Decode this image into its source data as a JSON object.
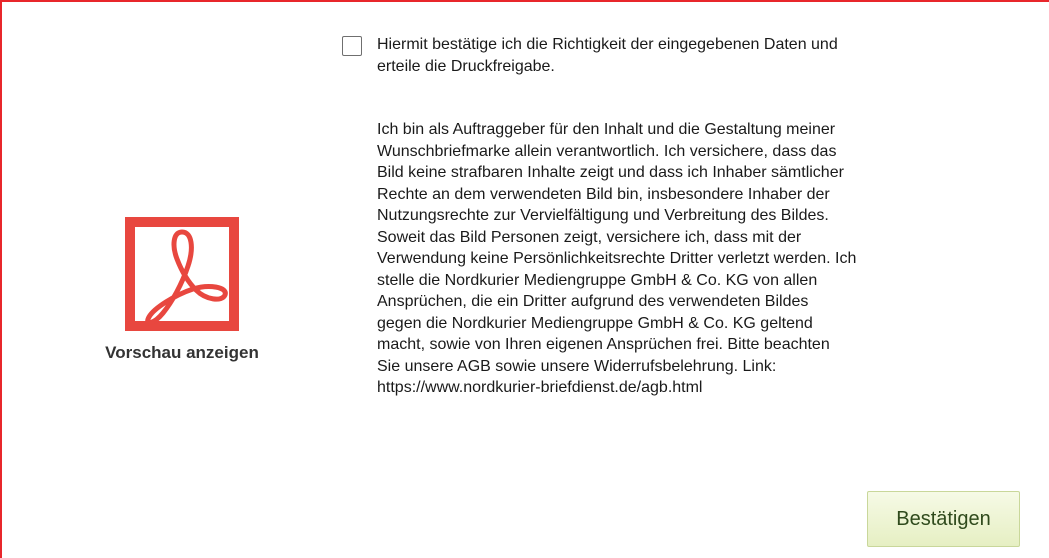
{
  "preview": {
    "icon": "pdf-icon",
    "label": "Vorschau anzeigen",
    "accent_color": "#e8473f"
  },
  "confirmation": {
    "checked": false,
    "label_line1": "Hiermit bestätige ich die Richtigkeit der eingegebenen Daten und",
    "label_line2": "erteile die Druckfreigabe."
  },
  "legal": {
    "lines": [
      "Ich bin als Auftraggeber für den Inhalt und die Gestaltung meiner",
      "Wunschbriefmarke allein verantwortlich. Ich versichere, dass das",
      "Bild keine strafbaren Inhalte zeigt und dass ich Inhaber sämtlicher",
      "Rechte an dem verwendeten Bild bin, insbesondere Inhaber der",
      "Nutzungsrechte zur Vervielfältigung und Verbreitung des Bildes.",
      "Soweit das Bild Personen zeigt, versichere ich, dass mit der",
      "Verwendung keine Persönlichkeitsrechte Dritter verletzt werden. Ich",
      "stelle die Nordkurier Mediengruppe GmbH & Co. KG von allen",
      "Ansprüchen, die ein Dritter aufgrund des verwendeten Bildes",
      "gegen die Nordkurier Mediengruppe GmbH & Co. KG geltend",
      "macht, sowie von Ihren eigenen Ansprüchen frei. Bitte beachten",
      "Sie unsere AGB sowie unsere Widerrufsbelehrung. Link:",
      "https://www.nordkurier-briefdienst.de/agb.html"
    ]
  },
  "actions": {
    "confirm_label": "Bestätigen"
  },
  "colors": {
    "frame_border": "#e8262b",
    "button_background": "#eaf2cc"
  }
}
